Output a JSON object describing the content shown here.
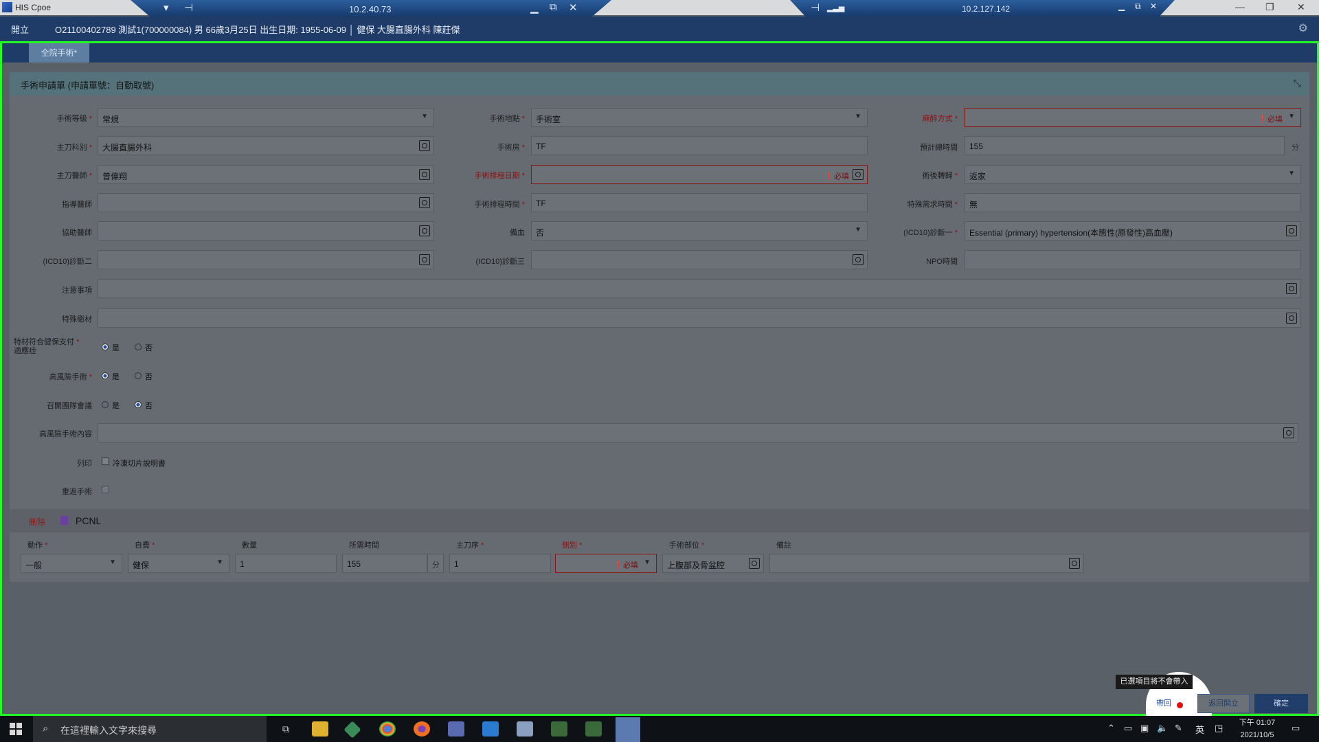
{
  "window": {
    "title": "HIS Cpoe"
  },
  "rdp": {
    "left_ip": "10.2.40.73",
    "right_ip": "10.2.127.142"
  },
  "patient": {
    "open_label": "開立",
    "info": "O21100402789  測試1(700000084)  男  66歲3月25日  出生日期: 1955-06-09  │  健保  大腸直腸外科  陳莊傑"
  },
  "tab": {
    "label": "全院手術*"
  },
  "panel": {
    "title": "手術申請單 (申請單號：自動取號)"
  },
  "required_text": "必填",
  "form": {
    "surgery_level": {
      "label": "手術等級",
      "value": "常規"
    },
    "surgery_location": {
      "label": "手術地點",
      "value": "手術室"
    },
    "anesthesia": {
      "label": "麻醉方式",
      "value": ""
    },
    "dept": {
      "label": "主刀科別",
      "value": "大腸直腸外科"
    },
    "room": {
      "label": "手術房",
      "value": "TF"
    },
    "est_time": {
      "label": "預計總時間",
      "value": "155",
      "unit": "分"
    },
    "surgeon": {
      "label": "主刀醫師",
      "value": "曾偉翔"
    },
    "sched_date": {
      "label": "手術排程日期",
      "value": ""
    },
    "post_op": {
      "label": "術後轉歸",
      "value": "返家"
    },
    "instructor": {
      "label": "指導醫師",
      "value": ""
    },
    "sched_time": {
      "label": "手術排程時間",
      "value": "TF"
    },
    "special_time": {
      "label": "特殊需求時間",
      "value": "無"
    },
    "assistant": {
      "label": "協助醫師",
      "value": ""
    },
    "blood": {
      "label": "備血",
      "value": "否"
    },
    "icd1": {
      "label": "(ICD10)診斷一",
      "value": "Essential (primary) hypertension(本態性(原發性)高血壓)"
    },
    "icd2": {
      "label": "(ICD10)診斷二",
      "value": ""
    },
    "icd3": {
      "label": "(ICD10)診斷三",
      "value": ""
    },
    "npo": {
      "label": "NPO時間",
      "value": ""
    },
    "notes": {
      "label": "注意事項",
      "value": ""
    },
    "special_material": {
      "label": "特殊衛材",
      "value": ""
    },
    "material_nhi": {
      "label_line1": "特材符合健保支付",
      "label_line2": "適應症",
      "yes": "是",
      "no": "否",
      "selected": "是"
    },
    "high_risk": {
      "label": "高風險手術",
      "yes": "是",
      "no": "否",
      "selected": "是"
    },
    "team_meeting": {
      "label": "召開團隊會議",
      "yes": "是",
      "no": "否",
      "selected": "否"
    },
    "high_risk_content": {
      "label": "高風險手術內容",
      "value": ""
    },
    "print": {
      "label": "列印",
      "option": "冷凍切片說明書",
      "checked": false
    },
    "major_surgery": {
      "label": "重返手術",
      "checked": false
    }
  },
  "procedure": {
    "delete_label": "刪除",
    "name": "PCNL",
    "columns": {
      "action": "動作",
      "payment": "自費",
      "qty": "數量",
      "time": "所需時間",
      "order": "主刀序",
      "side": "側別",
      "site": "手術部位",
      "remark": "備註"
    },
    "values": {
      "action": "一般",
      "payment": "健保",
      "qty": "1",
      "time": "155",
      "time_unit": "分",
      "order": "1",
      "side": "",
      "site": "上腹部及骨盆腔",
      "remark": ""
    }
  },
  "footer": {
    "tooltip": "已選項目將不會帶入",
    "reset_label": "帶回",
    "return_label": "返回開立",
    "confirm_label": "確定"
  },
  "taskbar": {
    "search_placeholder": "在這裡輸入文字來搜尋",
    "ime": "英",
    "time": "下午 01:07",
    "date": "2021/10/5"
  }
}
